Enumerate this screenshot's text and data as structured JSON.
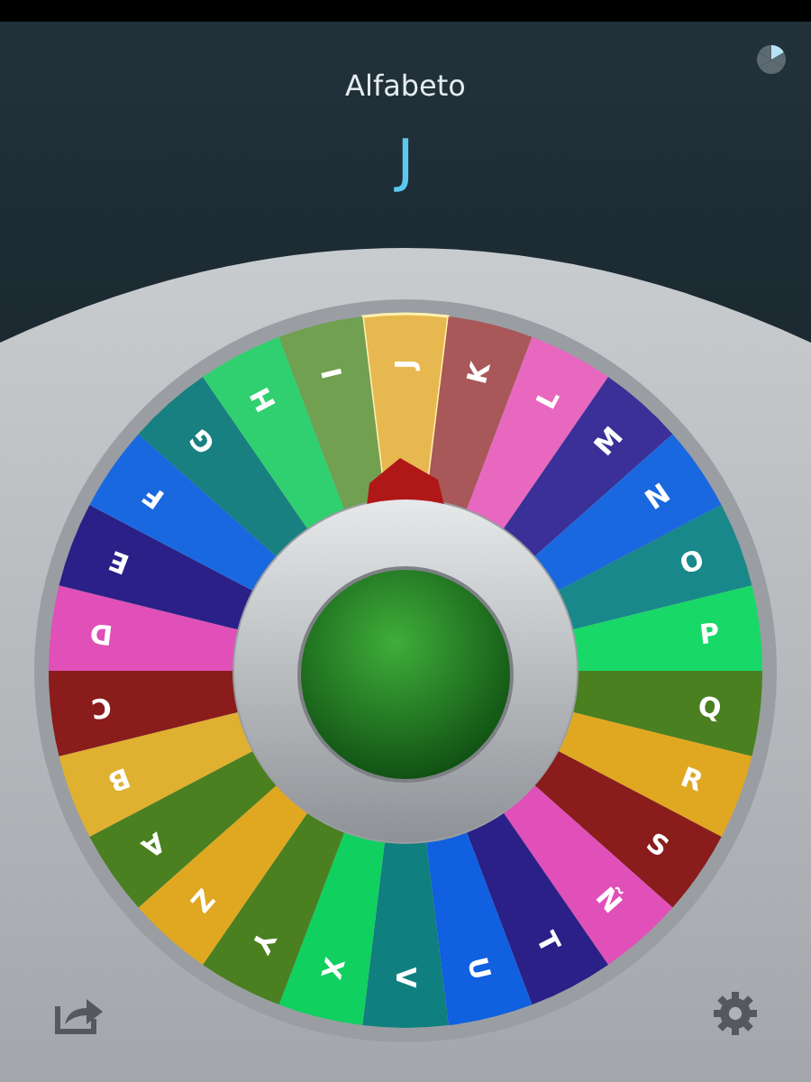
{
  "app": {
    "title": "Alfabeto",
    "result": "J"
  },
  "wheel": {
    "segments": [
      {
        "label": "J",
        "color": "#e8b850",
        "selected": true
      },
      {
        "label": "K",
        "color": "#a85858",
        "selected": false
      },
      {
        "label": "L",
        "color": "#e868c0",
        "selected": false
      },
      {
        "label": "M",
        "color": "#3a3098",
        "selected": false
      },
      {
        "label": "N",
        "color": "#1a68e0",
        "selected": false
      },
      {
        "label": "O",
        "color": "#18888a",
        "selected": false
      },
      {
        "label": "P",
        "color": "#18d868",
        "selected": false
      },
      {
        "label": "Q",
        "color": "#4a8020",
        "selected": false
      },
      {
        "label": "R",
        "color": "#e0a820",
        "selected": false
      },
      {
        "label": "S",
        "color": "#8a1c1c",
        "selected": false
      },
      {
        "label": "Ñ",
        "color": "#e050b8",
        "selected": false
      },
      {
        "label": "T",
        "color": "#2a2088",
        "selected": false
      },
      {
        "label": "U",
        "color": "#1060e0",
        "selected": false
      },
      {
        "label": "V",
        "color": "#107f80",
        "selected": false
      },
      {
        "label": "X",
        "color": "#10d060",
        "selected": false
      },
      {
        "label": "Y",
        "color": "#4a8020",
        "selected": false
      },
      {
        "label": "Z",
        "color": "#e0a820",
        "selected": false
      },
      {
        "label": "A",
        "color": "#4a8020",
        "selected": false
      },
      {
        "label": "B",
        "color": "#e0b030",
        "selected": false
      },
      {
        "label": "C",
        "color": "#8a1c1c",
        "selected": false
      },
      {
        "label": "D",
        "color": "#e050b8",
        "selected": false
      },
      {
        "label": "E",
        "color": "#2a2088",
        "selected": false
      },
      {
        "label": "F",
        "color": "#1a68e0",
        "selected": false
      },
      {
        "label": "G",
        "color": "#188080",
        "selected": false
      },
      {
        "label": "H",
        "color": "#30d070",
        "selected": false
      },
      {
        "label": "I",
        "color": "#70a050",
        "selected": false
      }
    ]
  }
}
